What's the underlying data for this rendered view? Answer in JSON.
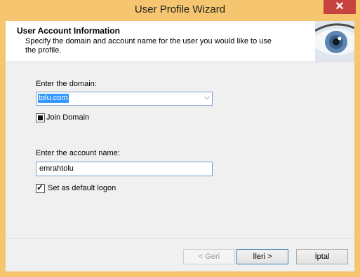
{
  "window": {
    "title": "User Profile Wizard",
    "close_label": "✕"
  },
  "header": {
    "title": "User Account  Information",
    "description": "Specify the domain and account name for the user you would like to use the profile."
  },
  "domain": {
    "label": "Enter the domain:",
    "value": "tolu.com"
  },
  "join_domain": {
    "label": "Join Domain"
  },
  "account": {
    "label": "Enter the account name:",
    "value": "emrahtolu"
  },
  "default_logon": {
    "label": "Set as default logon"
  },
  "buttons": {
    "back": "< Geri",
    "next": "İleri >",
    "cancel": "İptal"
  }
}
